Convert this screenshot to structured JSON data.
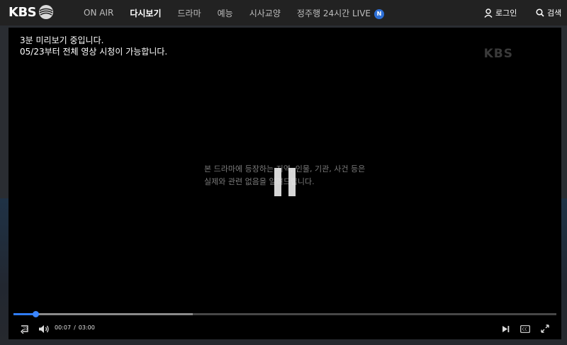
{
  "brand": {
    "logo_text": "KBS"
  },
  "nav": {
    "items": [
      "ON AIR",
      "다시보기",
      "드라마",
      "예능",
      "시사교양",
      "정주행 24시간 LIVE"
    ],
    "live_badge": "N"
  },
  "header": {
    "login_label": "로그인",
    "search_label": "검색"
  },
  "player": {
    "notice_line1": "3분 미리보기 중입니다.",
    "notice_line2": "05/23부터 전체 영상 시청이 가능합니다.",
    "watermark": "KBS",
    "caption_line1": "본 드라마에 등장하는 지역, 인물, 기관, 사건 등은",
    "caption_line2": "실제와 관련 없음을 알려드립니다.",
    "current_time": "00:07",
    "time_separator": "/",
    "duration": "03:00",
    "played_fraction": 0.04,
    "buffered_fraction": 0.33
  },
  "colors": {
    "accent": "#2f7cf6",
    "live_badge": "#2d6fd6"
  },
  "icons": [
    "replay-icon",
    "volume-icon",
    "next-icon",
    "cc-icon",
    "fullscreen-icon",
    "user-icon",
    "search-icon",
    "pause-icon"
  ]
}
